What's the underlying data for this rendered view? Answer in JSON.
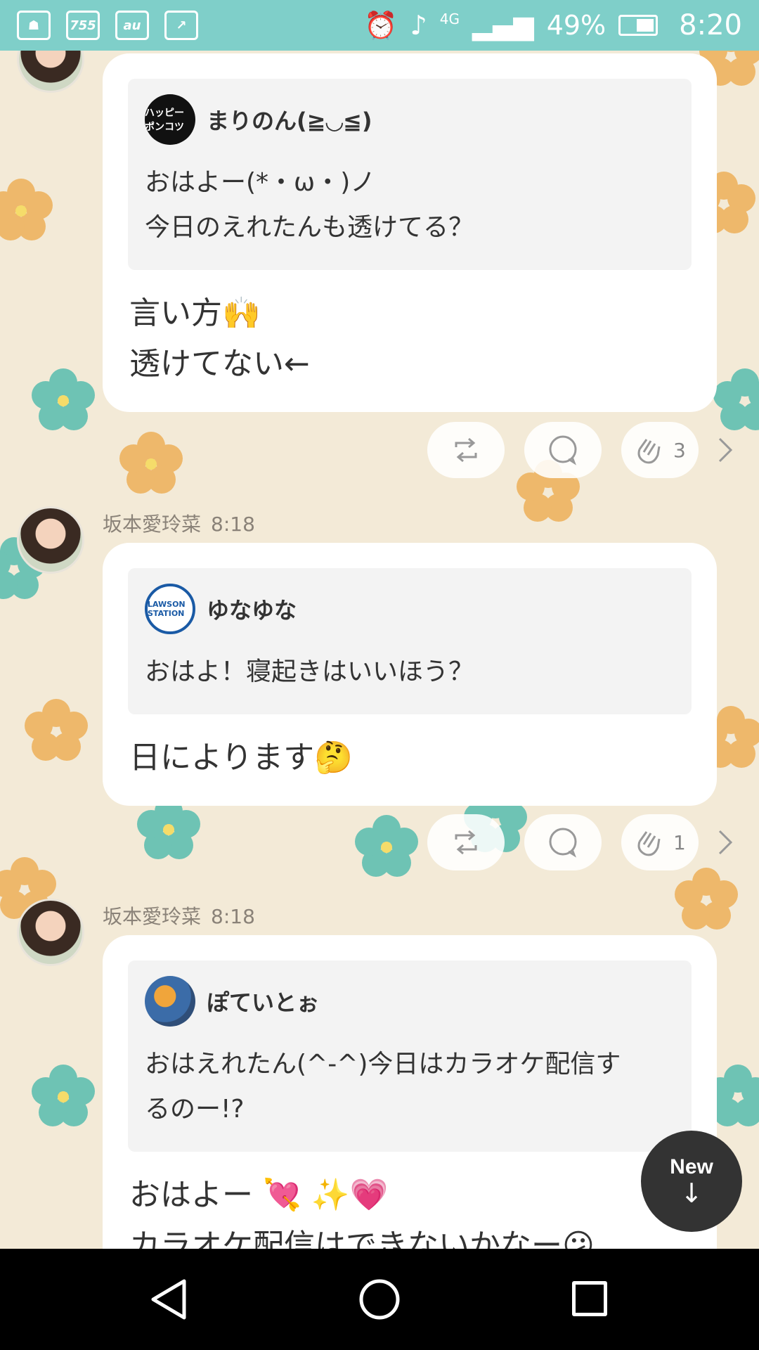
{
  "status_bar": {
    "app_icons": [
      "contacts-icon",
      "755",
      "au",
      "share-icon"
    ],
    "network": "4G",
    "battery": "49%",
    "time": "8:20"
  },
  "posts": [
    {
      "author": "",
      "time": "",
      "quote": {
        "user": "まりのん(≧◡≦)",
        "avatar_text": "ハッピー ポンコツ",
        "text": "おはよー(*・ω・)ノ\n今日のえれたんも透けてる？"
      },
      "reply": "言い方🙌\n透けてない←",
      "claps": "3"
    },
    {
      "author": "坂本愛玲菜",
      "time": "8:18",
      "quote": {
        "user": "ゆなゆな",
        "avatar_text": "LAWSON STATION",
        "text": "おはよ！寝起きはいいほう？"
      },
      "reply": "日によります🤔",
      "claps": "1"
    },
    {
      "author": "坂本愛玲菜",
      "time": "8:18",
      "quote": {
        "user": "ぽていとぉ",
        "avatar_text": "",
        "text": "おはえれたん(^-^)今日はカラオケ配信す\nるのー!?"
      },
      "reply": "おはよー 💘 ✨💗\nカラオケ配信はできないかなー😕",
      "claps": ""
    }
  ],
  "new_button": {
    "label": "New",
    "arrow": "↓"
  },
  "colors": {
    "status_bar": "#7fcfc9",
    "background": "#f3ead7",
    "flower_orange": "#eeb35f",
    "flower_teal": "#5fbfb0"
  }
}
